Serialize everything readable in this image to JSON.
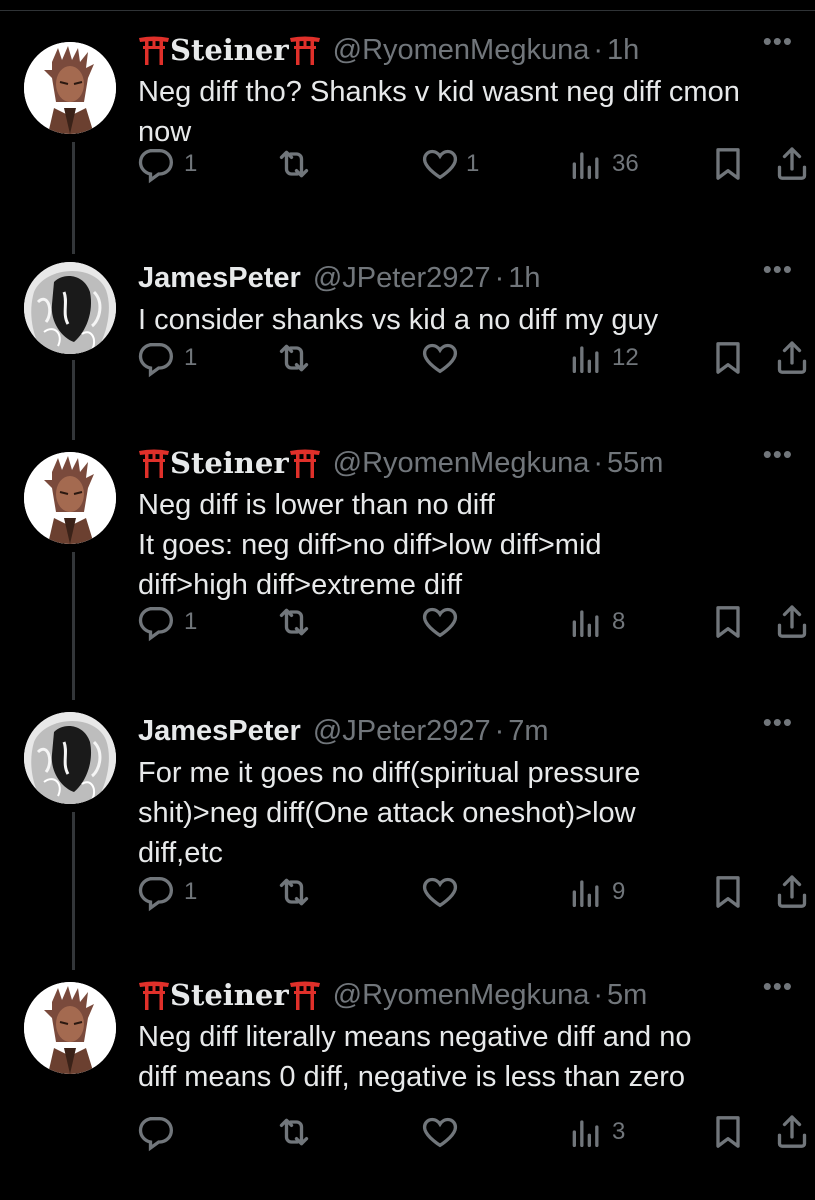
{
  "colors": {
    "background": "#000000",
    "text": "#e7e9ea",
    "muted": "#71767b",
    "torii": "#e0302a",
    "thread_line": "#333639"
  },
  "tweets": [
    {
      "display_name": "Steiner",
      "name_style": "torii",
      "handle": "@RyomenMegkuna",
      "sep": "·",
      "time": "1h",
      "more": "•••",
      "text": "Neg diff tho? Shanks v kid wasnt neg diff cmon\nnow",
      "replies": "1",
      "retweets": "",
      "likes": "1",
      "views": "36",
      "icons": [
        "reply-icon",
        "retweet-icon",
        "like-icon",
        "views-icon",
        "bookmark-icon",
        "share-icon"
      ]
    },
    {
      "display_name": "JamesPeter",
      "name_style": "plain",
      "handle": "@JPeter2927",
      "sep": "·",
      "time": "1h",
      "more": "•••",
      "text": "I consider shanks vs kid a no diff my guy",
      "replies": "1",
      "retweets": "",
      "likes": "",
      "views": "12",
      "icons": [
        "reply-icon",
        "retweet-icon",
        "like-icon",
        "views-icon",
        "bookmark-icon",
        "share-icon"
      ]
    },
    {
      "display_name": "Steiner",
      "name_style": "torii",
      "handle": "@RyomenMegkuna",
      "sep": "·",
      "time": "55m",
      "more": "•••",
      "text": "Neg diff is lower than no diff\nIt goes: neg diff>no diff>low diff>mid\ndiff>high diff>extreme diff",
      "replies": "1",
      "retweets": "",
      "likes": "",
      "views": "8",
      "icons": [
        "reply-icon",
        "retweet-icon",
        "like-icon",
        "views-icon",
        "bookmark-icon",
        "share-icon"
      ]
    },
    {
      "display_name": "JamesPeter",
      "name_style": "plain",
      "handle": "@JPeter2927",
      "sep": "·",
      "time": "7m",
      "more": "•••",
      "text": "For me it goes no diff(spiritual pressure\nshit)>neg diff(One attack oneshot)>low\ndiff,etc",
      "replies": "1",
      "retweets": "",
      "likes": "",
      "views": "9",
      "icons": [
        "reply-icon",
        "retweet-icon",
        "like-icon",
        "views-icon",
        "bookmark-icon",
        "share-icon"
      ]
    },
    {
      "display_name": "Steiner",
      "name_style": "torii",
      "handle": "@RyomenMegkuna",
      "sep": "·",
      "time": "5m",
      "more": "•••",
      "text": "Neg diff literally means negative diff and no\ndiff means 0 diff, negative is less than zero",
      "replies": "",
      "retweets": "",
      "likes": "",
      "views": "3",
      "icons": [
        "reply-icon",
        "retweet-icon",
        "like-icon",
        "views-icon",
        "bookmark-icon",
        "share-icon"
      ]
    }
  ]
}
